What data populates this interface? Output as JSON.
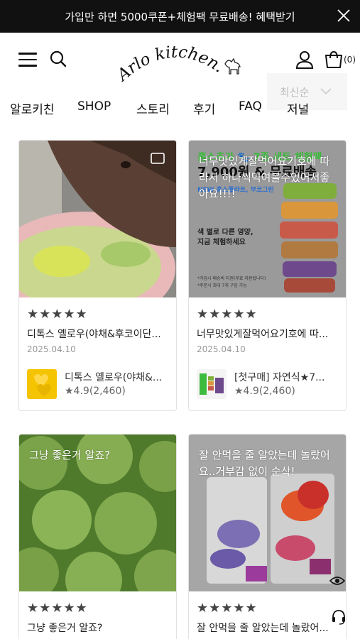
{
  "banner": {
    "text": "가입만 하면 5000쿠폰+체험팩 무료배송! 혜택받기"
  },
  "header": {
    "logo_text": "Arlo kitchen.",
    "cart_count": "(0)"
  },
  "sort": {
    "label": "최신순"
  },
  "nav": {
    "items": [
      "알로키친",
      "SHOP",
      "스토리",
      "후기",
      "FAQ",
      "저널"
    ]
  },
  "reviews": [
    {
      "overlay": "",
      "stars": "★★★★★",
      "title": "디톡스 옐로우(야채&후코이단...",
      "date": "2025.04.10",
      "product_name": "디톡스 옐로우(야채&...",
      "product_rating": "★4.9(2,460)"
    },
    {
      "overlay": "너무맛있게잘먹어요기호에 따라서 하나씩먹여볼수있어서좋아요!!!!",
      "promo_line1": "홈스추가 🐾 7종 세트 체험팩",
      "promo_line2": "7,900원 & 무료배송",
      "promo_line3": "NEW 홈스플라트, 부코그린",
      "promo_line4": "색 별로 다른 영양,",
      "promo_line5": "지금 체험하세요",
      "promo_note1": "*가입시 배송비 지원(무료 지원됩니다)",
      "promo_note2": "*주문시 최대 7개 구입 가능",
      "stars": "★★★★★",
      "title": "너무맛있게잘먹어요기호에 따...",
      "date": "2025.04.10",
      "product_name": "[첫구매] 자연식★7...",
      "product_rating": "★4.9(2,460)"
    },
    {
      "overlay": "그냥 좋은거 알죠?",
      "stars": "★★★★★",
      "title": "그냥 좋은거 알죠?"
    },
    {
      "overlay": "잘 안먹을 줄 알았는데 놀랐어요..거부감 없이 순삭!",
      "stars": "★★★★★",
      "title": "잘 안먹을 줄 알았는데 놀랐어..."
    }
  ],
  "colors": {
    "banner_bg": "#111111",
    "card_border": "#e2e2e2",
    "promo_green": "#2e9b2e"
  }
}
